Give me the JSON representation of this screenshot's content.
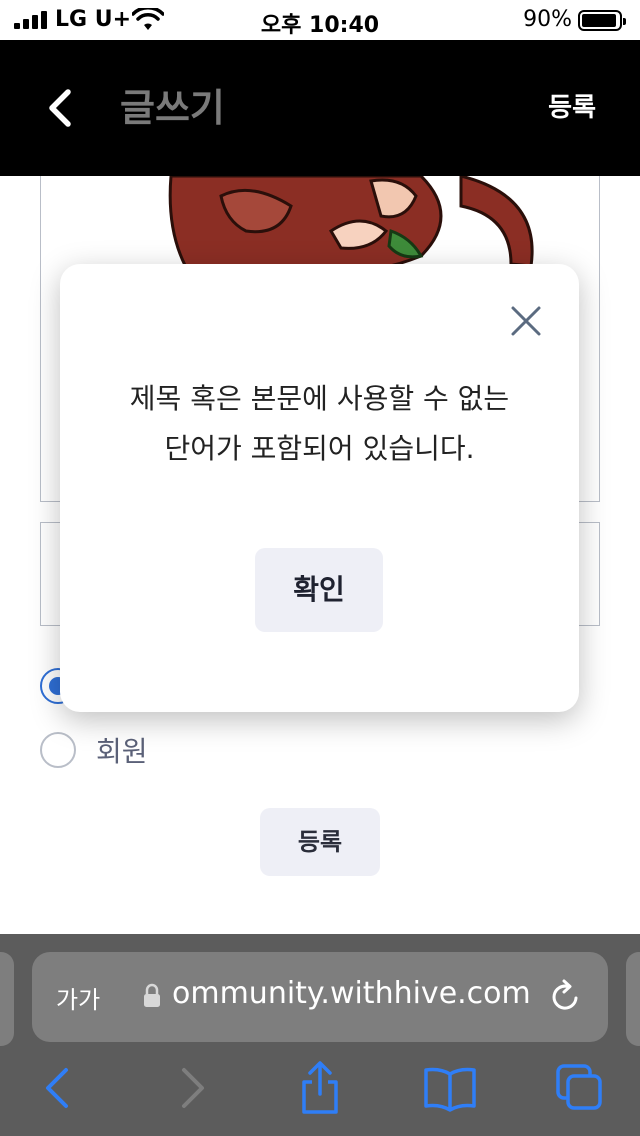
{
  "status_bar": {
    "carrier": "LG U+",
    "time": "오후 10:40",
    "battery_percent": "90%",
    "battery_level": 0.9
  },
  "header": {
    "title": "글쓰기",
    "register_label": "등록",
    "back_icon": "chevron-left-icon",
    "background": "#000000"
  },
  "form": {
    "radio_options": [
      {
        "label": "",
        "selected": true
      },
      {
        "label": "회원",
        "selected": false
      }
    ],
    "register_button_label": "등록"
  },
  "modal": {
    "message_line1": "제목 혹은 본문에 사용할 수 없는",
    "message_line2": "단어가 포함되어 있습니다.",
    "ok_label": "확인",
    "close_icon": "close-icon"
  },
  "safari": {
    "aa_label": "가가",
    "url_text": "ommunity.withhive.com",
    "icons": [
      "lock-icon",
      "reload-icon",
      "back-arrow-icon",
      "forward-arrow-icon",
      "share-icon",
      "bookmarks-icon",
      "tabs-icon"
    ]
  },
  "colors": {
    "accent": "#2f6fd6",
    "safari_icon": "#2f7ef7",
    "button_bg": "#eeeff6"
  }
}
